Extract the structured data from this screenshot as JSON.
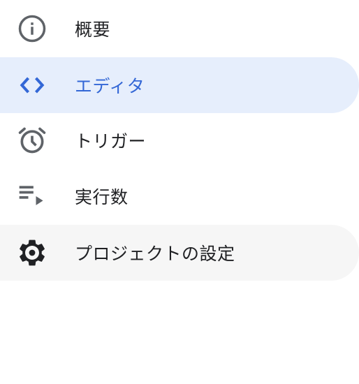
{
  "nav": {
    "items": [
      {
        "label": "概要",
        "icon": "info-icon",
        "state": "default"
      },
      {
        "label": "エディタ",
        "icon": "code-icon",
        "state": "active"
      },
      {
        "label": "トリガー",
        "icon": "alarm-clock-icon",
        "state": "default"
      },
      {
        "label": "実行数",
        "icon": "playlist-play-icon",
        "state": "default"
      },
      {
        "label": "プロジェクトの設定",
        "icon": "gear-icon",
        "state": "hovered"
      }
    ]
  },
  "colors": {
    "active_background": "#e6eefc",
    "active_text": "#3367d6",
    "hover_background": "#f6f6f6",
    "icon": "#5f6368",
    "text": "#202124"
  }
}
